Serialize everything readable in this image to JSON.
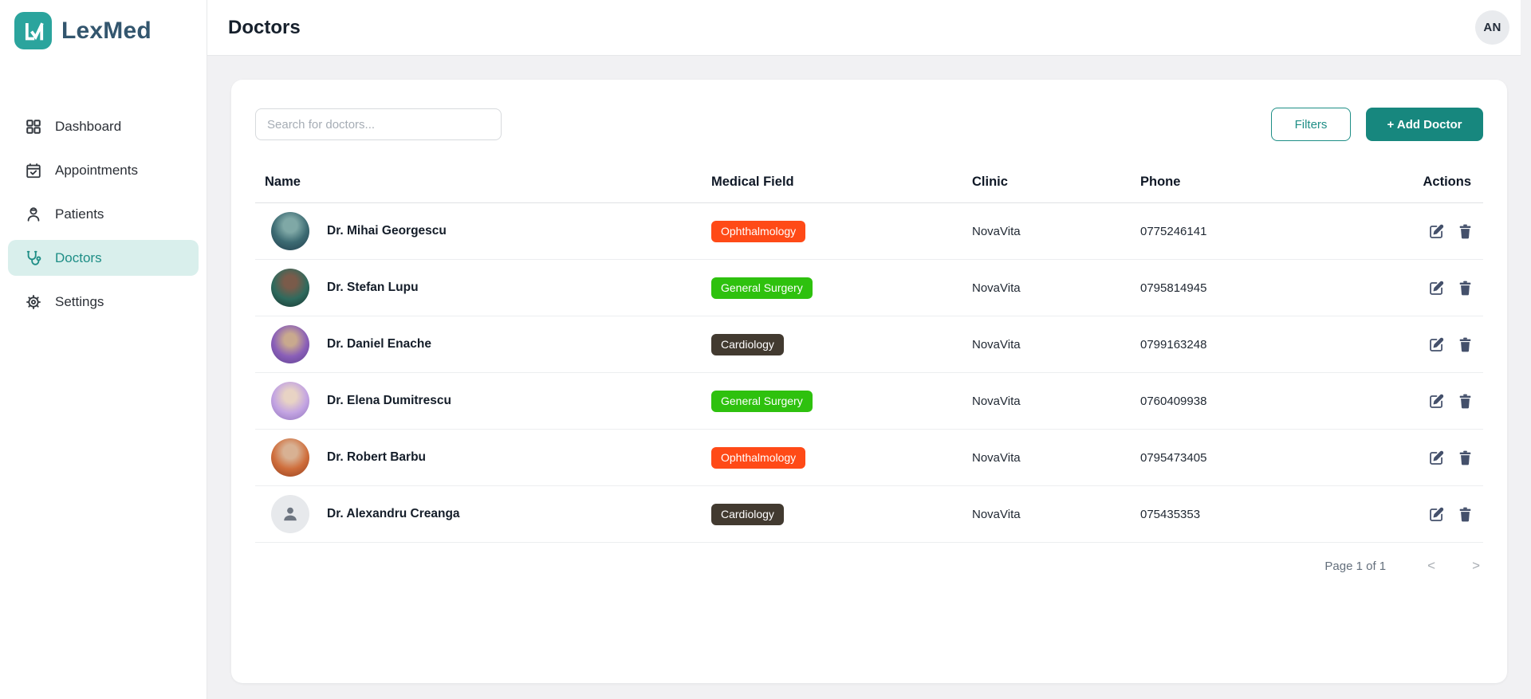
{
  "colors": {
    "accent": "#1E8E86",
    "accent_dark": "#17877E",
    "accent_light": "#D9EFEC",
    "brand_teal": "#2BA49D",
    "brand_text": "#33566E",
    "badge_ophthalmology": "#FF4A17",
    "badge_general_surgery": "#2EC10E",
    "badge_cardiology": "#423A30"
  },
  "brand": {
    "name": "LexMed"
  },
  "sidebar": {
    "items": [
      {
        "label": "Dashboard",
        "icon": "dashboard-grid-icon",
        "active": false
      },
      {
        "label": "Appointments",
        "icon": "calendar-check-icon",
        "active": false
      },
      {
        "label": "Patients",
        "icon": "patient-icon",
        "active": false
      },
      {
        "label": "Doctors",
        "icon": "stethoscope-icon",
        "active": true
      },
      {
        "label": "Settings",
        "icon": "gear-icon",
        "active": false
      }
    ]
  },
  "header": {
    "title": "Doctors",
    "avatar_initials": "AN"
  },
  "toolbar": {
    "search_placeholder": "Search for doctors...",
    "filters_label": "Filters",
    "add_doctor_label": "+ Add Doctor"
  },
  "table": {
    "columns": {
      "name": "Name",
      "field": "Medical Field",
      "clinic": "Clinic",
      "phone": "Phone",
      "actions": "Actions"
    },
    "rows": [
      {
        "name": "Dr. Mihai Georgescu",
        "field": "Ophthalmology",
        "field_color": "#FF4A17",
        "clinic": "NovaVita",
        "phone": "0775246141"
      },
      {
        "name": "Dr. Stefan Lupu",
        "field": "General Surgery",
        "field_color": "#2EC10E",
        "clinic": "NovaVita",
        "phone": "0795814945"
      },
      {
        "name": "Dr. Daniel Enache",
        "field": "Cardiology",
        "field_color": "#423A30",
        "clinic": "NovaVita",
        "phone": "0799163248"
      },
      {
        "name": "Dr. Elena Dumitrescu",
        "field": "General Surgery",
        "field_color": "#2EC10E",
        "clinic": "NovaVita",
        "phone": "0760409938"
      },
      {
        "name": "Dr. Robert Barbu",
        "field": "Ophthalmology",
        "field_color": "#FF4A17",
        "clinic": "NovaVita",
        "phone": "0795473405"
      },
      {
        "name": "Dr. Alexandru Creanga",
        "field": "Cardiology",
        "field_color": "#423A30",
        "clinic": "NovaVita",
        "phone": "075435353"
      }
    ]
  },
  "pagination": {
    "label": "Page 1 of 1",
    "prev_symbol": "<",
    "next_symbol": ">"
  }
}
